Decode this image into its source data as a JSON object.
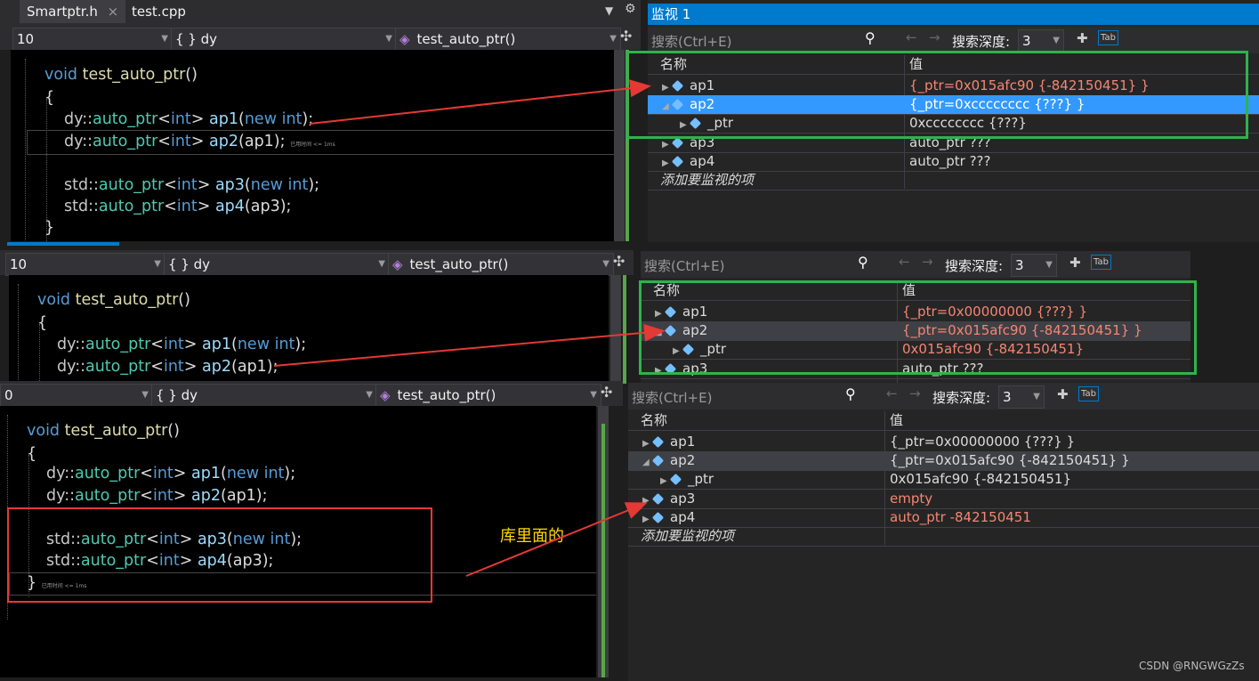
{
  "tabs": [
    "Smartptr.h",
    "test.cpp"
  ],
  "tab_close": "×",
  "nav": {
    "scope": [
      "10",
      "10",
      "0"
    ],
    "namespace": "{ } dy",
    "function": "test_auto_ptr()"
  },
  "code": {
    "sig_kw": "void",
    "sig_fn": "test_auto_ptr",
    "sig_paren": "()",
    "open": "{",
    "close": "}",
    "dy_ns": "dy::",
    "std_ns": "std::",
    "tmpl": "auto_ptr",
    "lt": "<",
    "int": "int",
    "gt": ">",
    "ap1": "ap1",
    "ap2": "ap2",
    "ap3": "ap3",
    "ap4": "ap4",
    "new_arg_open": "(",
    "new": "new",
    "new_int": " int",
    "new_arg_close": ");",
    "copy_ap1": "(ap1);",
    "copy_ap3": "(ap3);",
    "elapsed": "已用时间 <= 1ms"
  },
  "watch": {
    "title": "监视 1",
    "search_placeholder": "搜索(Ctrl+E)",
    "depth_label": "搜索深度:",
    "depth_value": "3",
    "col_name": "名称",
    "col_value": "值",
    "add_watch": "添加要监视的项",
    "panel1": [
      {
        "name": "ap1",
        "value": "{_ptr=0x015afc90 {-842150451} }",
        "changed": true
      },
      {
        "name": "ap2",
        "value": "{_ptr=0xcccccccc {???} }",
        "selected": true
      },
      {
        "name": "_ptr",
        "value": "0xcccccccc {???}"
      },
      {
        "name": "ap3",
        "value": "auto_ptr ???"
      },
      {
        "name": "ap4",
        "value": "auto_ptr ???"
      }
    ],
    "panel2": [
      {
        "name": "ap1",
        "value": "{_ptr=0x00000000 {???} }",
        "changed": true
      },
      {
        "name": "ap2",
        "value": "{_ptr=0x015afc90 {-842150451} }",
        "changed": true
      },
      {
        "name": "_ptr",
        "value": "0x015afc90 {-842150451}",
        "changed": true
      },
      {
        "name": "ap3",
        "value": "auto_ptr ???"
      }
    ],
    "panel3": [
      {
        "name": "ap1",
        "value": "{_ptr=0x00000000 {???} }"
      },
      {
        "name": "ap2",
        "value": "{_ptr=0x015afc90 {-842150451} }"
      },
      {
        "name": "_ptr",
        "value": "0x015afc90 {-842150451}"
      },
      {
        "name": "ap3",
        "value": "empty",
        "changed": true
      },
      {
        "name": "ap4",
        "value": "auto_ptr -842150451",
        "changed": true
      }
    ]
  },
  "annotation": "库里面的",
  "watermark": "CSDN @RNGWGzZs",
  "colors": {
    "highlight_box": "#2fb34a",
    "arrow": "#e53935",
    "annotation": "#ffd700"
  }
}
